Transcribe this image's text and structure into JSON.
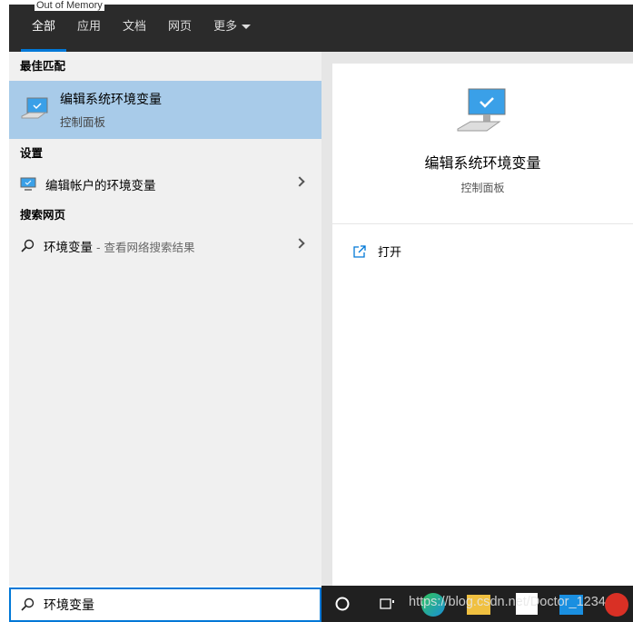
{
  "background_text": "Out of Memory",
  "tabs": [
    {
      "label": "全部",
      "active": true
    },
    {
      "label": "应用"
    },
    {
      "label": "文档"
    },
    {
      "label": "网页"
    },
    {
      "label": "更多"
    }
  ],
  "best_match": {
    "heading": "最佳匹配",
    "title": "编辑系统环境变量",
    "subtitle": "控制面板"
  },
  "settings": {
    "heading": "设置",
    "item": "编辑帐户的环境变量"
  },
  "web": {
    "heading": "搜索网页",
    "query": "环境变量",
    "suffix": " - 查看网络搜索结果"
  },
  "detail": {
    "title": "编辑系统环境变量",
    "subtitle": "控制面板",
    "action": "打开"
  },
  "search": {
    "value": "环境变量"
  },
  "watermark": "https://blog.csdn.net/Doctor_1234",
  "colors": {
    "accent": "#0078d7",
    "selected": "#a8cbe9",
    "header": "#2b2b2b"
  }
}
